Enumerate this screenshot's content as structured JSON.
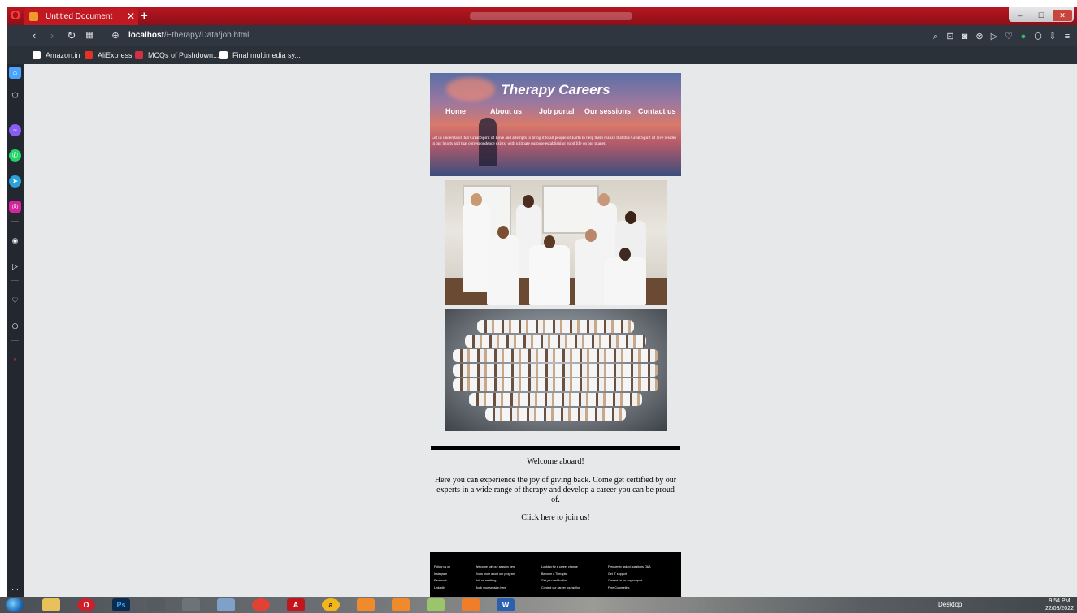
{
  "browser": {
    "tab_title": "Untitled Document",
    "new_tab": "+",
    "tab_close": "✕",
    "url_host": "localhost",
    "url_path": "/Etherapy/Data/job.html",
    "bookmarks": [
      {
        "label": "Amazon.in",
        "icon_color": "#ffffff"
      },
      {
        "label": "AliExpress",
        "icon_color": "#e43225"
      },
      {
        "label": "MCQs of Pushdown...",
        "icon_color": "#d62f43"
      },
      {
        "label": "Final multimedia sy...",
        "icon_color": "#ffffff"
      }
    ],
    "sidebar_icons": [
      "home-icon",
      "pentagon-icon",
      "messenger-icon",
      "whatsapp-icon",
      "telegram-icon",
      "instagram-icon",
      "player-icon",
      "flow-icon",
      "heart-icon",
      "history-icon",
      "pin-icon",
      "more-icon"
    ]
  },
  "site": {
    "title": "Therapy Careers",
    "nav": [
      "Home",
      "About us",
      "Job portal",
      "Our sessions",
      "Contact us"
    ],
    "banner_text": "Let us understand that Great Spirit of Love and attempts to bring it to all people of Earth to help them realize that this Great Spirit of love resides in our hearts and that correspondence exists, with ultimate purpose establishing good life on our planet.",
    "welcome": "Welcome aboard!",
    "description": "Here you can experience the joy of giving back. Come get certified by our experts in a wide range of therapy and develop a career you can be proud of.",
    "cta": "Click here to join us!",
    "footer": [
      [
        "Follow us on",
        "Instagram",
        "Facebook",
        "LinkedIn"
      ],
      [
        "Welcome join our session here",
        "Know more about our program",
        "Ask us anything",
        "Book your session here"
      ],
      [
        "Looking for a career change",
        "Become a Therapist",
        "Get you certification",
        "Contact our career counsellor"
      ],
      [
        "Frequently asked questions Q&A",
        "Get IT support",
        "Contact us for any support",
        "Free Counseling"
      ]
    ]
  },
  "taskbar": {
    "desktop_label": "Desktop",
    "time": "9:54 PM",
    "date": "22/03/2022"
  },
  "colors": {
    "opera_red": "#b41722",
    "toolbar": "#2f3640",
    "page_bg": "#e7e8ea"
  }
}
